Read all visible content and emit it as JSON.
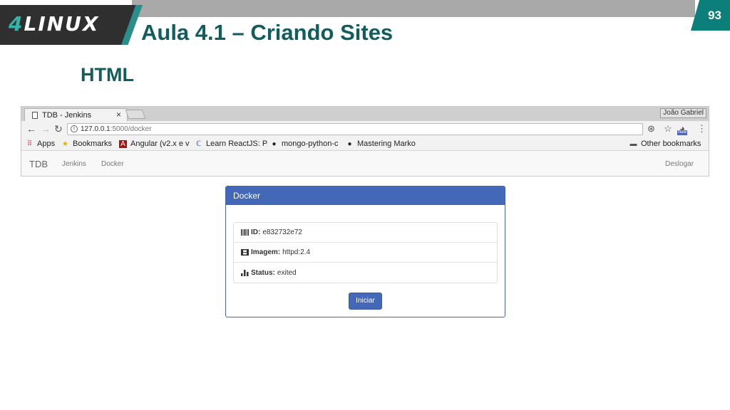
{
  "slide": {
    "page_number": "93",
    "logo_number": "4",
    "logo_word": "LINUX",
    "title": "Aula 4.1 – Criando Sites",
    "subtitle": "HTML"
  },
  "browser": {
    "tab_title": "TDB - Jenkins",
    "tab_close": "×",
    "profile_name": "João Gabriel",
    "url_host": "127.0.0.1",
    "url_path": ":5000/docker",
    "new_badge": "New",
    "bookmarks": [
      {
        "label": "Apps",
        "icon": "apps-grid-icon"
      },
      {
        "label": "Bookmarks",
        "icon": "star-icon"
      },
      {
        "label": "Angular (v2.x e v",
        "icon": "angular-icon"
      },
      {
        "label": "Learn ReactJS: P",
        "icon": "course-icon"
      },
      {
        "label": "mongo-python-c",
        "icon": "github-icon"
      },
      {
        "label": "Mastering Marko",
        "icon": "github-icon"
      }
    ],
    "other_bookmarks": "Other bookmarks"
  },
  "app": {
    "brand": "TDB",
    "nav": [
      "Jenkins",
      "Docker"
    ],
    "logout": "Deslogar"
  },
  "panel": {
    "heading": "Docker",
    "items": [
      {
        "label": "ID:",
        "value": "e832732e72",
        "icon": "barcode-icon"
      },
      {
        "label": "Imagem:",
        "value": "httpd:2.4",
        "icon": "film-icon"
      },
      {
        "label": "Status:",
        "value": "exited",
        "icon": "bar-chart-icon"
      }
    ],
    "button": "Iniciar"
  },
  "colors": {
    "teal_title": "#125c5c",
    "page_badge": "#0d7f7a",
    "panel_blue": "#4468b8"
  }
}
